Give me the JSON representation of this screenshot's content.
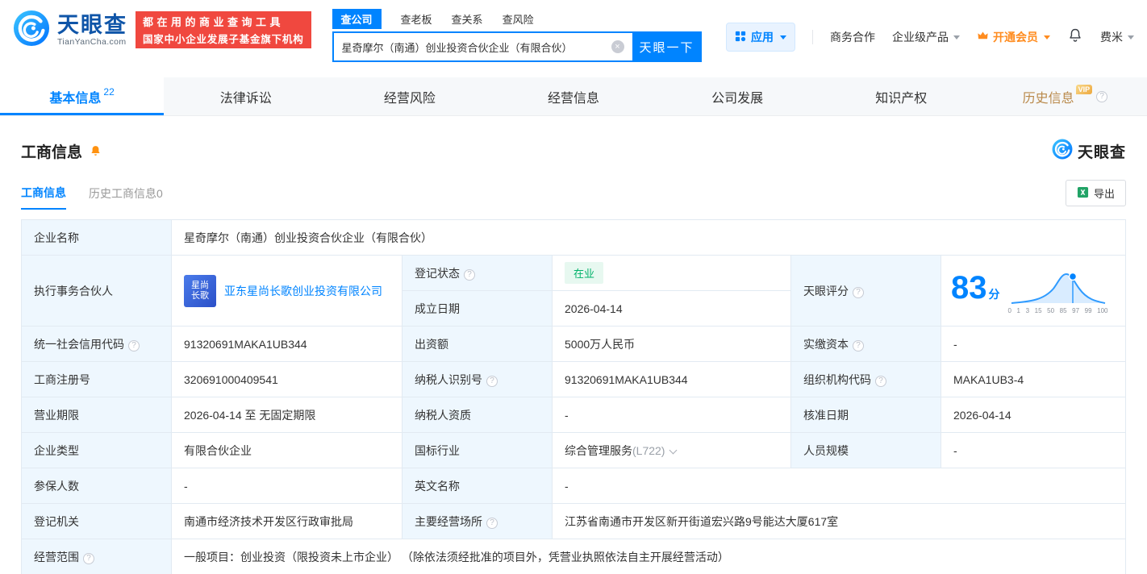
{
  "brand": {
    "name": "天眼查",
    "domain": "TianYanCha.com",
    "promo_line1": "都在用的商业查询工具",
    "promo_line2": "国家中小企业发展子基金旗下机构"
  },
  "search": {
    "tabs": [
      {
        "label": "查公司"
      },
      {
        "label": "查老板"
      },
      {
        "label": "查关系"
      },
      {
        "label": "查风险"
      }
    ],
    "query": "星奇摩尔（南通）创业投资合伙企业（有限合伙）",
    "submit_label": "天眼一下"
  },
  "topmenu": {
    "apps_label": "应用",
    "cooperation_label": "商务合作",
    "enterprise_label": "企业级产品",
    "vip_label": "开通会员",
    "user_label": "费米"
  },
  "nav": {
    "tabs": [
      {
        "label": "基本信息",
        "count": "22"
      },
      {
        "label": "法律诉讼"
      },
      {
        "label": "经营风险"
      },
      {
        "label": "经营信息"
      },
      {
        "label": "公司发展"
      },
      {
        "label": "知识产权"
      },
      {
        "label": "历史信息",
        "badge": "VIP"
      }
    ]
  },
  "section": {
    "title": "工商信息",
    "watermark": "天眼查",
    "subtabs": [
      {
        "label": "工商信息"
      },
      {
        "label": "历史工商信息",
        "count": "0"
      }
    ],
    "export_label": "导出"
  },
  "table": {
    "company_name": {
      "label": "企业名称",
      "value": "星奇摩尔（南通）创业投资合伙企业（有限合伙）"
    },
    "partner": {
      "label": "执行事务合伙人",
      "logo_line1": "星尚",
      "logo_line2": "长歌",
      "link": "亚东星尚长歌创业投资有限公司"
    },
    "reg_status": {
      "label": "登记状态",
      "value": "在业"
    },
    "establish_date": {
      "label": "成立日期",
      "value": "2026-04-14"
    },
    "score": {
      "label": "天眼评分",
      "value": "83",
      "unit": "分",
      "axis": [
        "0",
        "1",
        "3",
        "15",
        "50",
        "85",
        "97",
        "99",
        "100"
      ]
    },
    "credit_code": {
      "label": "统一社会信用代码",
      "value": "91320691MAKA1UB344"
    },
    "capital": {
      "label": "出资额",
      "value": "5000万人民币"
    },
    "paid_capital": {
      "label": "实缴资本",
      "value": "-"
    },
    "reg_number": {
      "label": "工商注册号",
      "value": "320691000409541"
    },
    "taxpayer_id": {
      "label": "纳税人识别号",
      "value": "91320691MAKA1UB344"
    },
    "org_code": {
      "label": "组织机构代码",
      "value": "MAKA1UB3-4"
    },
    "business_term": {
      "label": "营业期限",
      "value": "2026-04-14 至 无固定期限"
    },
    "taxpayer_quality": {
      "label": "纳税人资质",
      "value": "-"
    },
    "approval_date": {
      "label": "核准日期",
      "value": "2026-04-14"
    },
    "company_type": {
      "label": "企业类型",
      "value": "有限合伙企业"
    },
    "industry": {
      "label": "国标行业",
      "value": "综合管理服务",
      "code": "(L722)"
    },
    "staff_size": {
      "label": "人员规模",
      "value": "-"
    },
    "insured_count": {
      "label": "参保人数",
      "value": "-"
    },
    "english_name": {
      "label": "英文名称",
      "value": "-"
    },
    "reg_authority": {
      "label": "登记机关",
      "value": "南通市经济技术开发区行政审批局"
    },
    "business_place": {
      "label": "主要经营场所",
      "value": "江苏省南通市开发区新开街道宏兴路9号能达大厦617室"
    },
    "business_scope": {
      "label": "经营范围",
      "value": "一般项目：创业投资（限投资未上市企业） （除依法须经批准的项目外，凭营业执照依法自主开展经营活动）"
    }
  },
  "colors": {
    "primary_blue": "#0084ff",
    "promo_red": "#f0483f",
    "vip_orange": "#ff8c1f",
    "status_green": "#00b26a",
    "label_cell_bg": "#eef7fe"
  }
}
